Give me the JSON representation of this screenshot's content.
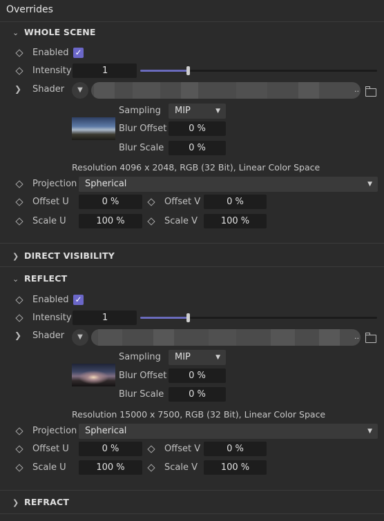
{
  "panel": {
    "title": "Overrides"
  },
  "sections": {
    "whole_scene": {
      "title": "WHOLE SCENE",
      "enabled_label": "Enabled",
      "enabled_checked": true,
      "intensity_label": "Intensity",
      "intensity_value": "1",
      "intensity_slider_level": 0.2,
      "shader_label": "Shader",
      "sampling_label": "Sampling",
      "sampling_value": "MIP",
      "blur_offset_label": "Blur Offset",
      "blur_offset_value": "0 %",
      "blur_scale_label": "Blur Scale",
      "blur_scale_value": "0 %",
      "resolution_text": "Resolution 4096 x 2048, RGB (32 Bit), Linear Color Space",
      "projection_label": "Projection",
      "projection_value": "Spherical",
      "offset_u_label": "Offset U",
      "offset_u_value": "0 %",
      "offset_v_label": "Offset V",
      "offset_v_value": "0 %",
      "scale_u_label": "Scale U",
      "scale_u_value": "100 %",
      "scale_v_label": "Scale V",
      "scale_v_value": "100 %"
    },
    "direct_visibility": {
      "title": "DIRECT VISIBILITY"
    },
    "reflect": {
      "title": "REFLECT",
      "enabled_label": "Enabled",
      "enabled_checked": true,
      "intensity_label": "Intensity",
      "intensity_value": "1",
      "intensity_slider_level": 0.2,
      "shader_label": "Shader",
      "sampling_label": "Sampling",
      "sampling_value": "MIP",
      "blur_offset_label": "Blur Offset",
      "blur_offset_value": "0 %",
      "blur_scale_label": "Blur Scale",
      "blur_scale_value": "0 %",
      "resolution_text": "Resolution 15000 x 7500, RGB (32 Bit), Linear Color Space",
      "projection_label": "Projection",
      "projection_value": "Spherical",
      "offset_u_label": "Offset U",
      "offset_u_value": "0 %",
      "offset_v_label": "Offset V",
      "offset_v_value": "0 %",
      "scale_u_label": "Scale U",
      "scale_u_value": "100 %",
      "scale_v_label": "Scale V",
      "scale_v_value": "100 %"
    },
    "refract": {
      "title": "REFRACT"
    }
  },
  "icons": {
    "keyframe": "keyframe-diamond-icon",
    "expand": "chevron-right-icon",
    "collapse": "chevron-down-icon",
    "folder": "folder-icon",
    "checkmark": "checkmark-icon"
  },
  "colors": {
    "background": "#2b2b2b",
    "field": "#1d1d1d",
    "accent": "#6b67c8",
    "text": "#c8c8c8"
  }
}
